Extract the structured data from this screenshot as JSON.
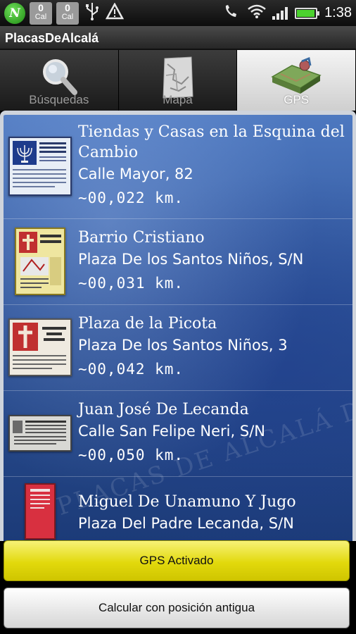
{
  "status_bar": {
    "cal_icons": [
      {
        "count": "0",
        "label": "Cal"
      },
      {
        "count": "0",
        "label": "Cal"
      }
    ],
    "time": "1:38",
    "icons": [
      "app-n-icon",
      "usb-icon",
      "warning-icon",
      "call-forward-icon",
      "wifi-icon",
      "signal-icon",
      "battery-icon"
    ],
    "battery_level": 0.95
  },
  "app": {
    "title": "PlacasDeAlcalá"
  },
  "tabs": [
    {
      "label": "Búsquedas",
      "icon": "magnifier-icon",
      "selected": false
    },
    {
      "label": "Mapa",
      "icon": "map-icon",
      "selected": false
    },
    {
      "label": "GPS",
      "icon": "gps-map-icon",
      "selected": true
    }
  ],
  "list": {
    "watermark": "PLACAS DE ALCALÁ DE HENARES",
    "items": [
      {
        "title": "Tiendas y Casas en la Esquina del Cambio",
        "address": "Calle Mayor, 82",
        "distance": "~00,022  km.",
        "plaque_text": "TIENDAS Y CASAS EN LA ESQUINA DEL CAMBIO"
      },
      {
        "title": "Barrio Cristiano",
        "address": "Plaza De los Santos Niños, S/N",
        "distance": "~00,031  km.",
        "plaque_text": "BARRIO CRISTIANO"
      },
      {
        "title": "Plaza de la Picota",
        "address": "Plaza De los Santos Niños, 3",
        "distance": "~00,042  km.",
        "plaque_text": "PLAZA DE LA PICOTA"
      },
      {
        "title": "Juan José De Lecanda",
        "address": "Calle San Felipe Neri, S/N",
        "distance": "~00,050  km.",
        "plaque_text": ""
      },
      {
        "title": "Miguel De Unamuno Y Jugo",
        "address": "Plaza Del Padre Lecanda, S/N",
        "distance": "",
        "plaque_text": ""
      }
    ]
  },
  "buttons": {
    "gps": "GPS Activado",
    "calc": "Calcular con posición antigua"
  },
  "colors": {
    "list_bg": "#2d5298",
    "gps_button": "#e2d90c",
    "battery": "#4cd22f"
  }
}
